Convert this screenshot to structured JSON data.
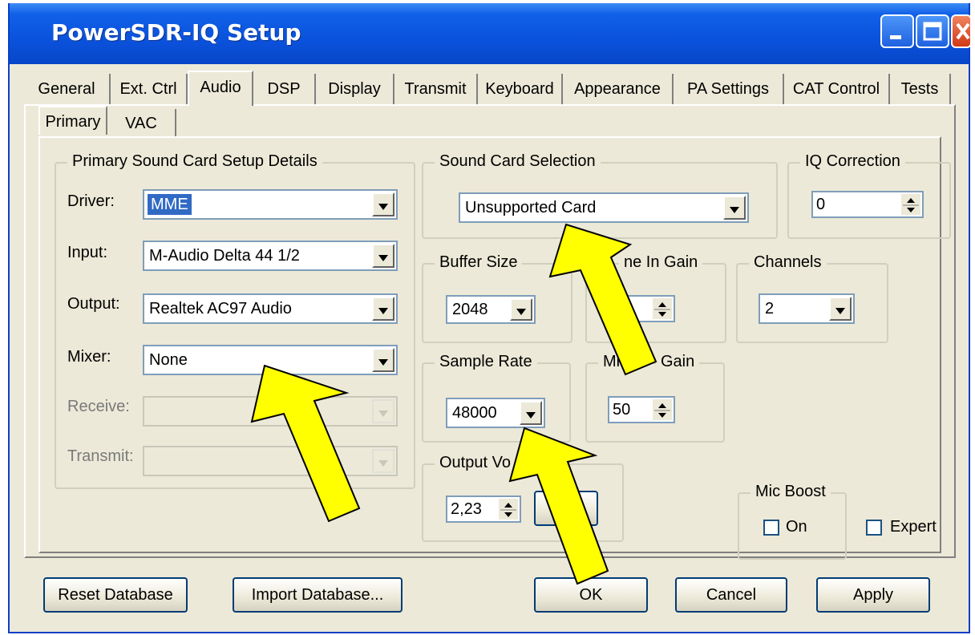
{
  "window": {
    "title": "PowerSDR-IQ Setup"
  },
  "tabs": [
    "General",
    "Ext. Ctrl",
    "Audio",
    "DSP",
    "Display",
    "Transmit",
    "Keyboard",
    "Appearance",
    "PA Settings",
    "CAT Control",
    "Tests"
  ],
  "subtabs": [
    "Primary",
    "VAC"
  ],
  "primary_group": {
    "title": "Primary Sound Card Setup Details",
    "driver": {
      "label": "Driver:",
      "value": "MME"
    },
    "input": {
      "label": "Input:",
      "value": "M-Audio Delta 44 1/2"
    },
    "output": {
      "label": "Output:",
      "value": "Realtek AC97 Audio"
    },
    "mixer": {
      "label": "Mixer:",
      "value": "None"
    },
    "receive": {
      "label": "Receive:",
      "value": ""
    },
    "transmit": {
      "label": "Transmit:",
      "value": ""
    }
  },
  "sound_card": {
    "title": "Sound Card Selection",
    "value": "Unsupported Card"
  },
  "iq_correction": {
    "title": "IQ Correction",
    "value": "0"
  },
  "buffer_size": {
    "title": "Buffer Size",
    "value": "2048"
  },
  "line_in_gain": {
    "title": "ne In Gain"
  },
  "channels": {
    "title": "Channels",
    "value": "2"
  },
  "sample_rate": {
    "title": "Sample Rate",
    "value": "48000"
  },
  "mic_gain": {
    "title_left": "Mic",
    "title_right": "Gain",
    "value": "50"
  },
  "output_volume": {
    "title": "Output Vo",
    "value": "2,23"
  },
  "mic_boost": {
    "title": "Mic Boost",
    "on_label": "On"
  },
  "expert": {
    "label": "Expert"
  },
  "buttons": {
    "reset": "Reset Database",
    "import": "Import Database...",
    "ok": "OK",
    "cancel": "Cancel",
    "apply": "Apply"
  },
  "colors": {
    "title_blue": "#0a52dc",
    "selection": "#316ac5",
    "arrow_fill": "#ffff00"
  }
}
